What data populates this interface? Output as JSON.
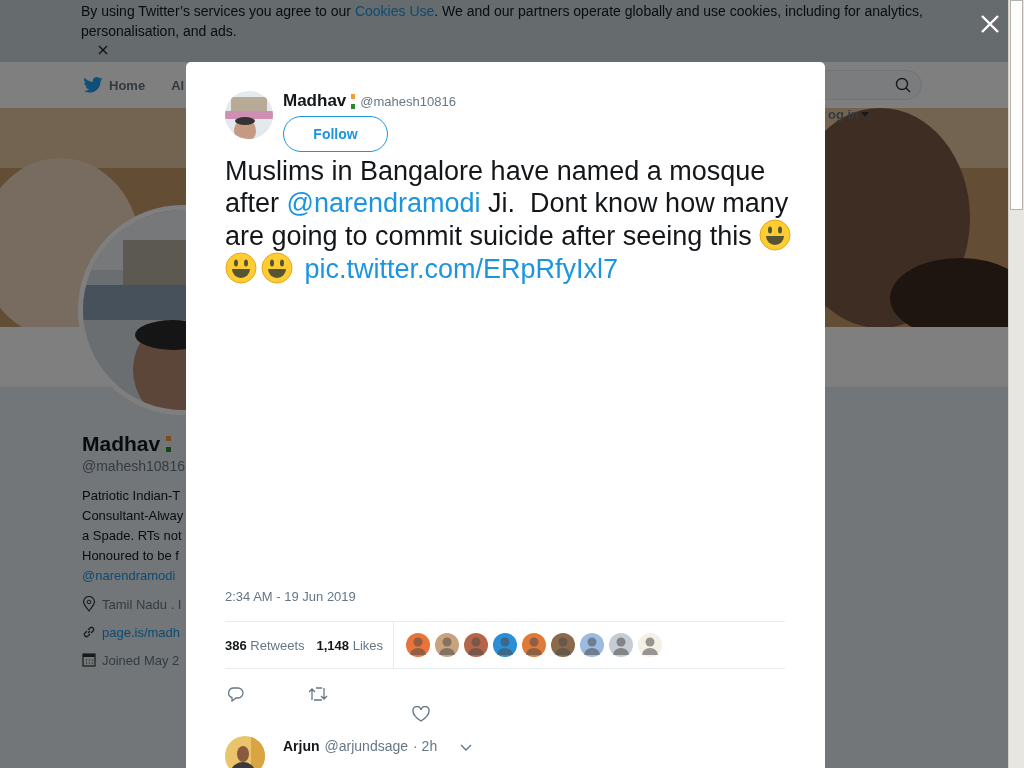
{
  "cookie_banner": {
    "text_before": "By using Twitter’s services you agree to our ",
    "link": "Cookies Use",
    "text_after": ". We and our partners operate globally and use cookies, including for analytics, personalisation, and ads."
  },
  "nav": {
    "home": "Home",
    "partial_item": "Al",
    "login": "og in"
  },
  "profile": {
    "name": "Madhav",
    "handle": "@mahesh10816",
    "bio": [
      "Patriotic Indian-T",
      "Consultant-Alway",
      "a Spade. RTs not",
      "Honoured to be f"
    ],
    "bio_mention": "@narendramodi",
    "location": "Tamil Nadu . I",
    "website": "page.is/madh",
    "joined": "Joined May 2"
  },
  "modal": {
    "author": {
      "name": "Madhav",
      "handle": "@mahesh10816"
    },
    "follow": "Follow",
    "tweet": [
      {
        "kind": "text",
        "text": "Muslims in Bangalore have named a mosque after "
      },
      {
        "kind": "mention",
        "text": "@narendramodi"
      },
      {
        "kind": "text",
        "text": " Ji.  Dont know how many are going to commit suicide after seeing this "
      },
      {
        "kind": "emoji"
      },
      {
        "kind": "emoji"
      },
      {
        "kind": "emoji"
      },
      {
        "kind": "link",
        "text": " pic.twitter.com/ERpRfyIxl7"
      }
    ],
    "timestamp": "2:34 AM - 19 Jun 2019",
    "retweets": {
      "count": "386",
      "label": "Retweets"
    },
    "likes": {
      "count": "1,148",
      "label": "Likes"
    },
    "reply": {
      "name": "Arjun",
      "handle": "@arjundsage",
      "time": "· 2h"
    }
  }
}
